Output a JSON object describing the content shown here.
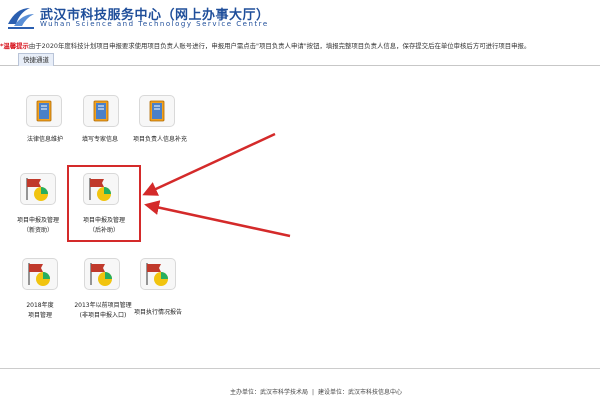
{
  "header": {
    "title_cn": "武汉市科技服务中心（网上办事大厅）",
    "title_en": "Wuhan Science and Technology Service Centre"
  },
  "notice": {
    "prefix": "*温馨提示",
    "text": "由于2020年度科技计划项目申报要求使用项目负责人账号进行，申报用户需点击\"项目负责人申请\"按钮，填报完整项目负责人信息，保存提交后在单位审核后方可进行项目申报。"
  },
  "tab": {
    "label": "快捷通道"
  },
  "tiles": [
    {
      "line1": "法律信息维护",
      "line2": ""
    },
    {
      "line1": "填写专家信息",
      "line2": ""
    },
    {
      "line1": "项目负责人信息补充",
      "line2": ""
    },
    {
      "line1": "项目申报及管理",
      "line2": "（新资助）"
    },
    {
      "line1": "项目申报及管理",
      "line2": "（后补助）"
    },
    {
      "line1": "2018年度",
      "line2": "项目管理"
    },
    {
      "line1": "2013年以前项目管理",
      "line2": "(非项目申报入口)"
    },
    {
      "line1": "项目执行情况报告",
      "line2": ""
    }
  ],
  "footer": {
    "host": "主办单位：武汉市科学技术局",
    "builder": "建设单位：武汉市科技信息中心"
  },
  "colors": {
    "title": "#1f4e9a",
    "notice_highlight": "#d8141e",
    "annotation": "#d42a2a"
  }
}
